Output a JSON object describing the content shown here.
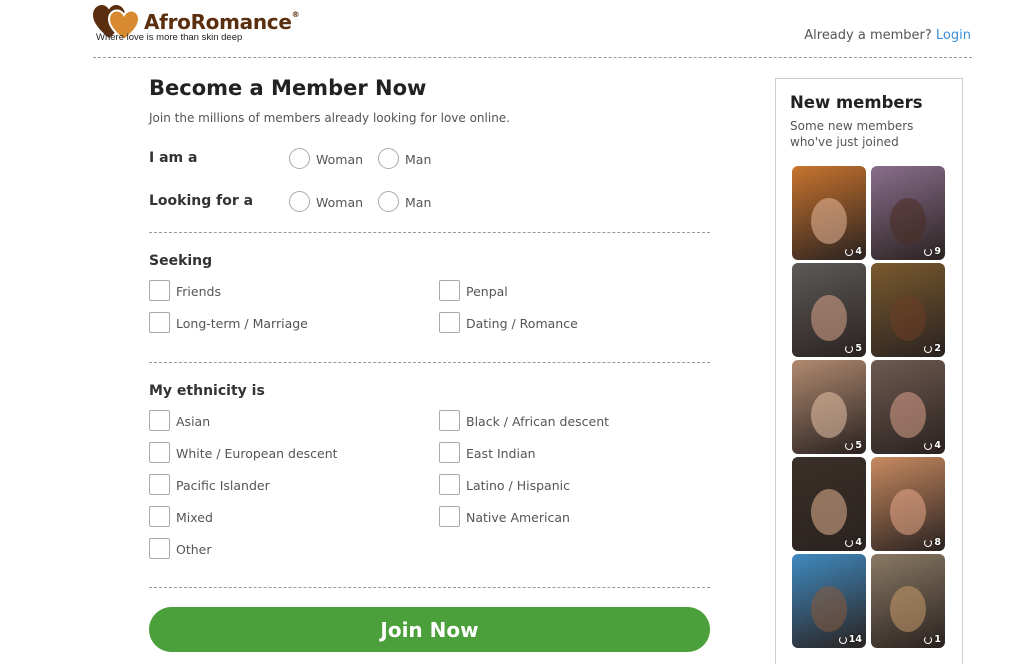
{
  "header": {
    "brand": "AfroRomance",
    "brand_mark": "®",
    "tagline": "Where love is more than skin deep",
    "member_prompt": "Already a member?",
    "login_label": "Login"
  },
  "form": {
    "title": "Become a Member Now",
    "subtitle": "Join the millions of members already looking for love online.",
    "i_am": {
      "label": "I am a",
      "options": [
        "Woman",
        "Man"
      ]
    },
    "looking_for": {
      "label": "Looking for a",
      "options": [
        "Woman",
        "Man"
      ]
    },
    "seeking": {
      "label": "Seeking",
      "options": [
        "Friends",
        "Penpal",
        "Long-term / Marriage",
        "Dating / Romance"
      ]
    },
    "ethnicity": {
      "label": "My ethnicity is",
      "options": [
        "Asian",
        "Black / African descent",
        "White / European descent",
        "East Indian",
        "Pacific Islander",
        "Latino / Hispanic",
        "Mixed",
        "Native American",
        "Other"
      ]
    },
    "join_label": "Join Now"
  },
  "sidebar": {
    "title": "New members",
    "subtitle": "Some new members who've just joined",
    "members": [
      {
        "photos": "4",
        "tone": "#c8742e",
        "face": "#e8b89a"
      },
      {
        "photos": "9",
        "tone": "#8a6e8c",
        "face": "#4a2c22"
      },
      {
        "photos": "5",
        "tone": "#5c5a58",
        "face": "#d9a48a"
      },
      {
        "photos": "2",
        "tone": "#7a5a2e",
        "face": "#6b3e26"
      },
      {
        "photos": "5",
        "tone": "#b08a70",
        "face": "#e6c2a8"
      },
      {
        "photos": "4",
        "tone": "#6e5a50",
        "face": "#d8a08a"
      },
      {
        "photos": "4",
        "tone": "#3a3028",
        "face": "#e0b090"
      },
      {
        "photos": "8",
        "tone": "#c88a60",
        "face": "#e8a888"
      },
      {
        "photos": "14",
        "tone": "#3f8ac0",
        "face": "#8a5a3a"
      },
      {
        "photos": "1",
        "tone": "#8a7a64",
        "face": "#c69a6a"
      }
    ]
  }
}
